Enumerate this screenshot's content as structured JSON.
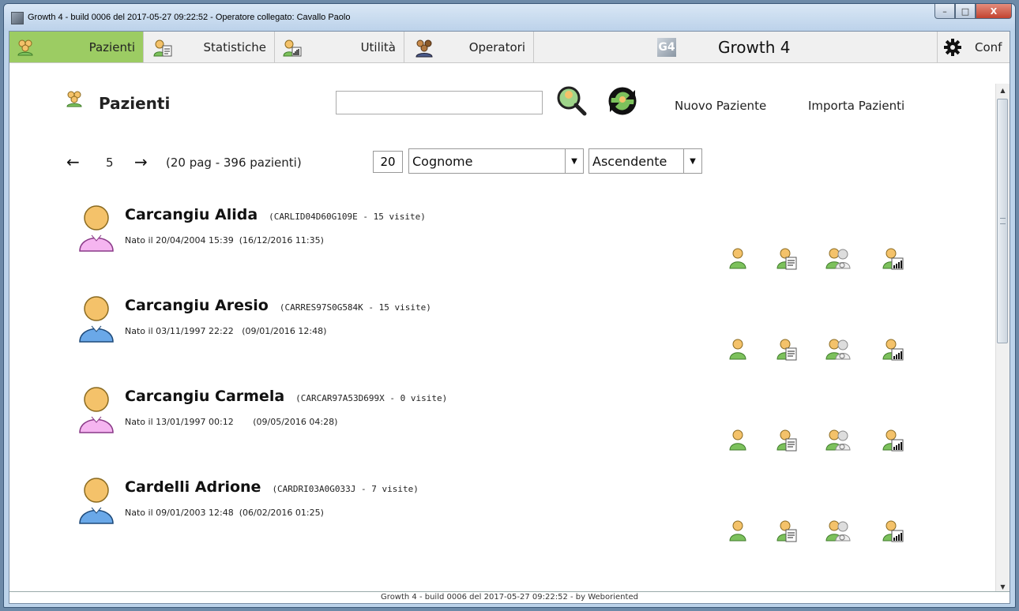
{
  "window": {
    "title": "Growth 4 - build 0006 del 2017-05-27 09:22:52 - Operatore collegato: Cavallo Paolo",
    "buttons": {
      "minimize": "–",
      "maximize": "□",
      "close": "X"
    }
  },
  "menu": {
    "items": [
      {
        "label": "Pazienti",
        "icon": "patients-icon",
        "active": true
      },
      {
        "label": "Statistiche",
        "icon": "statistics-icon",
        "active": false
      },
      {
        "label": "Utilità",
        "icon": "utility-icon",
        "active": false
      },
      {
        "label": "Operatori",
        "icon": "operators-icon",
        "active": false
      }
    ],
    "brand_logo": "G4",
    "brand_title": "Growth 4",
    "config_label": "Conf"
  },
  "main": {
    "title": "Pazienti",
    "search": {
      "value": "",
      "placeholder": ""
    },
    "links": {
      "new_patient": "Nuovo Paziente",
      "import_patients": "Importa Pazienti"
    }
  },
  "pager": {
    "current_page": "5",
    "summary": "(20 pag - 396 pazienti)",
    "page_size": "20",
    "sort_field": "Cognome",
    "sort_order": "Ascendente"
  },
  "patients": [
    {
      "name": "Carcangiu Alida",
      "code": "(CARLID04D60G109E - 15 visite)",
      "birth": "Nato il 20/04/2004 15:39",
      "last": "(16/12/2016 11:35)",
      "gender": "female"
    },
    {
      "name": "Carcangiu Aresio",
      "code": "(CARRES97S0G584K - 15 visite)",
      "birth": "Nato il 03/11/1997 22:22",
      "last": "(09/01/2016 12:48)",
      "gender": "male"
    },
    {
      "name": "Carcangiu Carmela",
      "code": "(CARCAR97A53D699X - 0 visite)",
      "birth": "Nato il 13/01/1997 00:12",
      "last": "(09/05/2016 04:28)",
      "gender": "female"
    },
    {
      "name": "Cardelli Adrione",
      "code": "(CARDRI03A0G033J - 7 visite)",
      "birth": "Nato il 09/01/2003 12:48",
      "last": "(06/02/2016 01:25)",
      "gender": "male"
    }
  ],
  "colors": {
    "accent": "#9ccc63",
    "female": "#f5b5f0",
    "male": "#6aa8e8",
    "skin": "#f4c26a"
  },
  "footer": "Growth 4 - build 0006 del 2017-05-27 09:22:52 - by Weboriented"
}
